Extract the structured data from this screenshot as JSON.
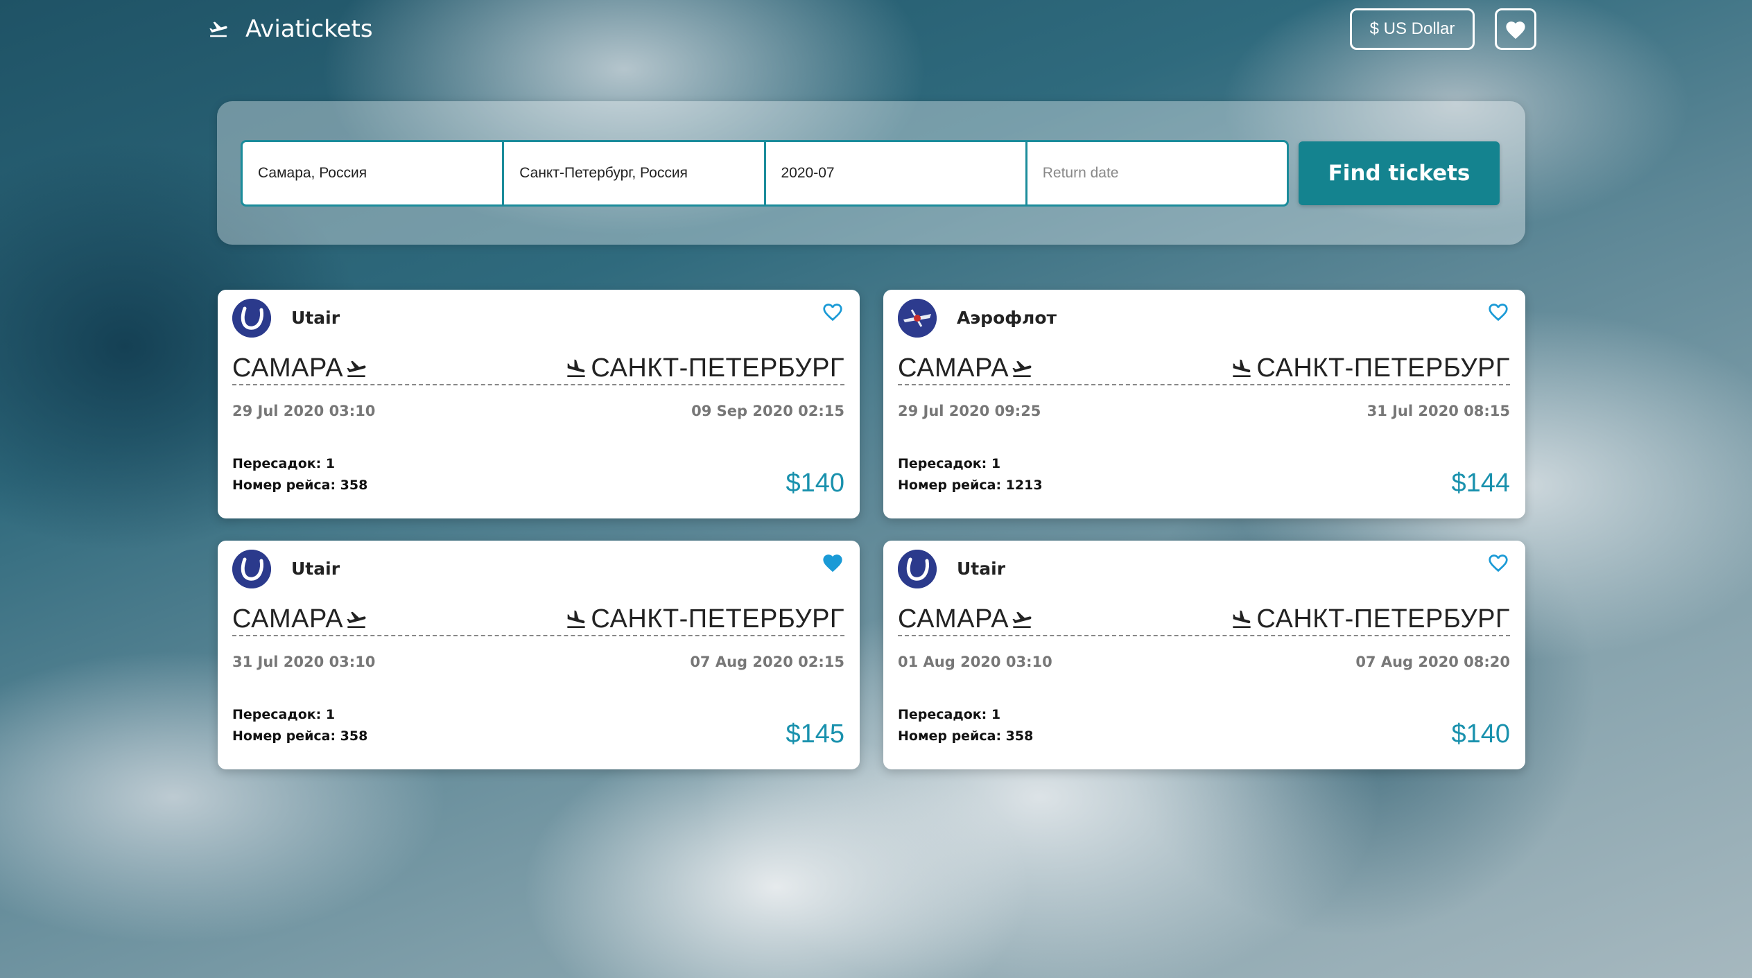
{
  "header": {
    "brand": "Aviatickets",
    "currency_label": "$ US Dollar"
  },
  "search": {
    "origin": "Самара, Россия",
    "destination": "Санкт-Петербург, Россия",
    "depart_date": "2020-07",
    "return_placeholder": "Return date",
    "find_label": "Find tickets"
  },
  "colors": {
    "accent": "#14838f",
    "price": "#1991ad",
    "heart": "#1a9ad6"
  },
  "tickets": [
    {
      "airline": "Utair",
      "logo": "utair-logo",
      "from": "САМАРА",
      "to": "САНКТ-ПЕТЕРБУРГ",
      "departure": "29 Jul 2020 03:10",
      "arrival": "09 Sep 2020 02:15",
      "transfers": "Пересадок: 1",
      "flight": "Номер рейса: 358",
      "price": "$140",
      "favorite": false
    },
    {
      "airline": "Аэрофлот",
      "logo": "aeroflot-logo",
      "from": "САМАРА",
      "to": "САНКТ-ПЕТЕРБУРГ",
      "departure": "29 Jul 2020 09:25",
      "arrival": "31 Jul 2020 08:15",
      "transfers": "Пересадок: 1",
      "flight": "Номер рейса: 1213",
      "price": "$144",
      "favorite": false
    },
    {
      "airline": "Utair",
      "logo": "utair-logo",
      "from": "САМАРА",
      "to": "САНКТ-ПЕТЕРБУРГ",
      "departure": "31 Jul 2020 03:10",
      "arrival": "07 Aug 2020 02:15",
      "transfers": "Пересадок: 1",
      "flight": "Номер рейса: 358",
      "price": "$145",
      "favorite": true
    },
    {
      "airline": "Utair",
      "logo": "utair-logo",
      "from": "САМАРА",
      "to": "САНКТ-ПЕТЕРБУРГ",
      "departure": "01 Aug 2020 03:10",
      "arrival": "07 Aug 2020 08:20",
      "transfers": "Пересадок: 1",
      "flight": "Номер рейса: 358",
      "price": "$140",
      "favorite": false
    }
  ]
}
